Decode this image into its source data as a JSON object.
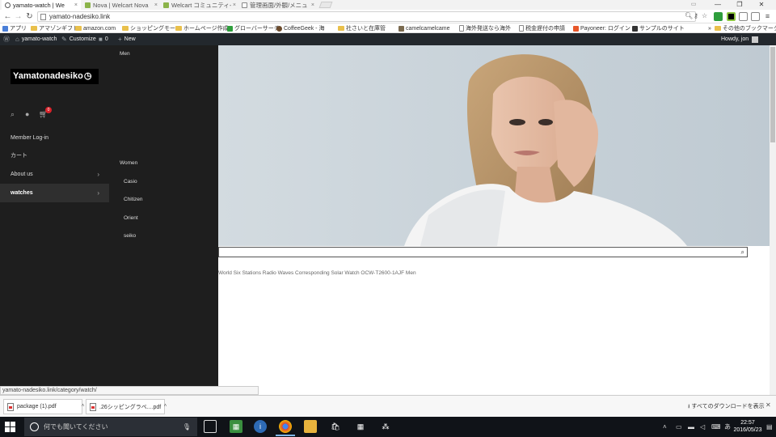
{
  "browser": {
    "tabs": [
      {
        "title": "yamato-watch | We",
        "active": true
      },
      {
        "title": "Nova | Welcart Nova",
        "active": false
      },
      {
        "title": "Welcart コミュニティ-[",
        "active": false
      },
      {
        "title": "管理画面/外観/メニュ",
        "active": false
      }
    ],
    "tab_close": "×",
    "window": {
      "minimize": "—",
      "maximize": "❐",
      "close": "✕"
    },
    "url": "yamato-nadesiko.link",
    "bookmarks": [
      "アプリ",
      "アマゾンギフト",
      "amazon.com",
      "ショッピングモール",
      "ホームページ作成",
      "グローバーサーチ",
      "CoffeeGeek - 海",
      "社さいと在庫管",
      "camelcamelcame",
      "海外発送なら海外",
      "税金遅付の申請",
      "Payoneer: ログイン",
      "サンプルのサイト",
      "その他のブックマーク"
    ]
  },
  "wp_admin_bar": {
    "site_name": "yamato-watch",
    "customize": "Customize",
    "comments_count": "0",
    "new_label": "New",
    "howdy": "Howdy, jon"
  },
  "site": {
    "logo": "Yamatonadesiko",
    "cart_count": "0",
    "menu": [
      {
        "label": "Member Log-in"
      },
      {
        "label": "カート"
      },
      {
        "label": "About us"
      },
      {
        "label": "watches"
      }
    ],
    "submenu": {
      "men": "Men",
      "women": "Women",
      "brands": [
        "Casio",
        "Chitizen",
        "Orient",
        "seiko"
      ]
    },
    "product_link": "World Six Stations Radio Waves Corresponding Solar Watch OCW-T2600-1AJF Men"
  },
  "status_bar_url": "yamato-nadesiko.link/category/watch/",
  "downloads": {
    "items": [
      "package (1).pdf",
      ".26シッピングラベ....pdf"
    ],
    "show_all": "すべてのダウンロードを表示"
  },
  "taskbar": {
    "search_placeholder": "何でも聞いてください",
    "time": "22:57",
    "date": "2016/05/23"
  },
  "colors": {
    "wp_admin_bg": "#23282d",
    "sidebar_bg": "#1e1e1e",
    "cart_badge": "#d9222a",
    "taskbar_bg": "#101318"
  }
}
